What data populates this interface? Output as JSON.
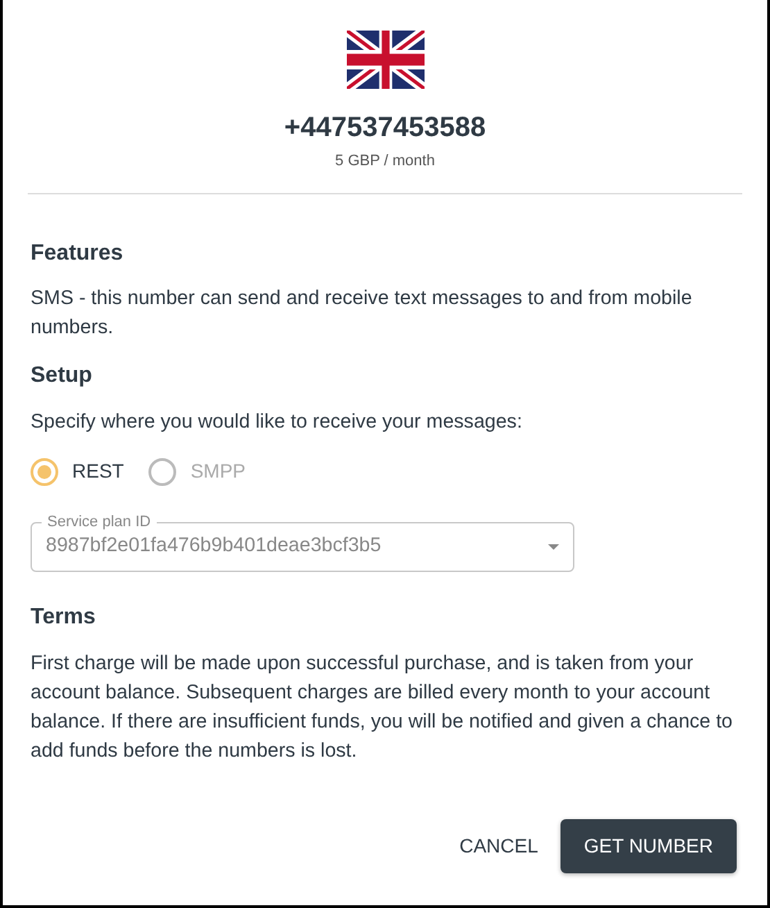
{
  "number": {
    "phone": "+447537453588",
    "price": "5 GBP / month"
  },
  "sections": [
    {
      "heading": "Features",
      "text": "SMS - this number can send and receive text messages to and from mobile numbers."
    },
    {
      "heading": "Setup",
      "text": "Specify where you would like to receive your messages:"
    }
  ],
  "radios": [
    {
      "label": "REST",
      "selected": true
    },
    {
      "label": "SMPP",
      "selected": false
    }
  ],
  "service_plan": {
    "label": "Service plan ID",
    "value": "8987bf2e01fa476b9b401deae3bcf3b5",
    "disabled": true
  },
  "terms": {
    "heading": "Terms",
    "text": "First charge will be made upon successful purchase, and is taken from your account balance. Subsequent charges are billed every month to your account balance. If there are insufficient funds, you will be notified and given a chance to add funds before the numbers is lost."
  },
  "buttons": [
    {
      "label": "CANCEL",
      "kind": "text"
    },
    {
      "label": "GET NUMBER",
      "kind": "primary"
    }
  ]
}
